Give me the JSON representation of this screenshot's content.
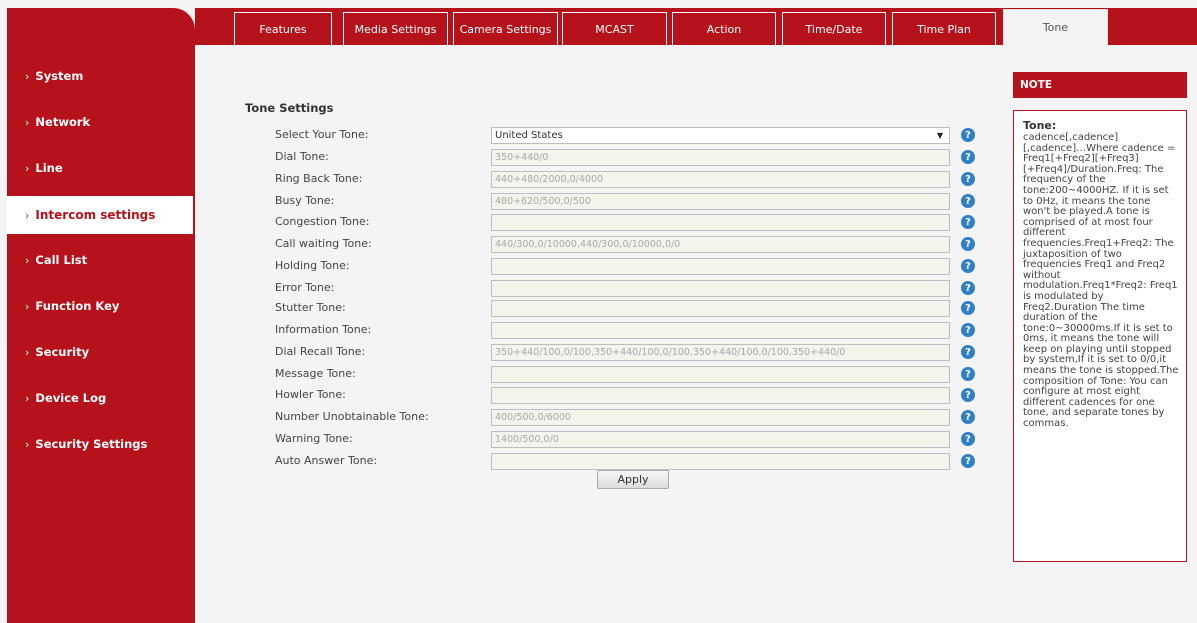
{
  "sidebar": {
    "items": [
      {
        "label": "System"
      },
      {
        "label": "Network"
      },
      {
        "label": "Line"
      },
      {
        "label": "Intercom settings"
      },
      {
        "label": "Call List"
      },
      {
        "label": "Function Key"
      },
      {
        "label": "Security"
      },
      {
        "label": "Device Log"
      },
      {
        "label": "Security Settings"
      }
    ],
    "chevron": "›",
    "active_index": 3
  },
  "tabs": [
    {
      "label": "Features"
    },
    {
      "label": "Media Settings"
    },
    {
      "label": "Camera Settings"
    },
    {
      "label": "MCAST"
    },
    {
      "label": "Action"
    },
    {
      "label": "Time/Date"
    },
    {
      "label": "Time Plan"
    },
    {
      "label": "Tone"
    }
  ],
  "tone_settings": {
    "title": "Tone Settings",
    "rows": [
      {
        "label": "Select Your Tone:",
        "value": "United States"
      },
      {
        "label": "Dial Tone:",
        "value": "350+440/0"
      },
      {
        "label": "Ring Back Tone:",
        "value": "440+480/2000,0/4000"
      },
      {
        "label": "Busy Tone:",
        "value": "480+620/500,0/500"
      },
      {
        "label": "Congestion Tone:",
        "value": ""
      },
      {
        "label": "Call waiting Tone:",
        "value": "440/300,0/10000,440/300,0/10000,0/0"
      },
      {
        "label": "Holding Tone:",
        "value": ""
      },
      {
        "label": "Error Tone:",
        "value": ""
      },
      {
        "label": "Stutter Tone:",
        "value": ""
      },
      {
        "label": "Information Tone:",
        "value": ""
      },
      {
        "label": "Dial Recall Tone:",
        "value": "350+440/100,0/100,350+440/100,0/100,350+440/100,0/100,350+440/0"
      },
      {
        "label": "Message Tone:",
        "value": ""
      },
      {
        "label": "Howler Tone:",
        "value": ""
      },
      {
        "label": "Number Unobtainable Tone:",
        "value": "400/500,0/6000"
      },
      {
        "label": "Warning Tone:",
        "value": "1400/500,0/0"
      },
      {
        "label": "Auto Answer Tone:",
        "value": ""
      }
    ],
    "help_glyph": "?",
    "select_arrow": "▼",
    "apply_label": "Apply"
  },
  "note": {
    "header": "NOTE",
    "title": "Tone:",
    "text": "cadence[,cadence][,cadence]…Where cadence = Freq1[+Freq2][+Freq3][+Freq4]/Duration.Freq: The frequency of the tone:200~4000HZ. If it is set to 0Hz, it means the tone won't be played.A tone is comprised of at most four different frequencies.Freq1+Freq2: The juxtaposition of two frequencies Freq1 and Freq2 without modulation.Freq1*Freq2: Freq1 is modulated by Freq2.Duration The time duration of the tone:0~30000ms.If it is set to 0ms, it means the tone will keep on playing until stopped by system,If it is set to 0/0,it means the tone is stopped.The composition of Tone: You can configure at most eight different cadences for one tone, and separate tones by commas."
  },
  "colors": {
    "brand": "#b5121b",
    "help": "#2f7fc4"
  }
}
